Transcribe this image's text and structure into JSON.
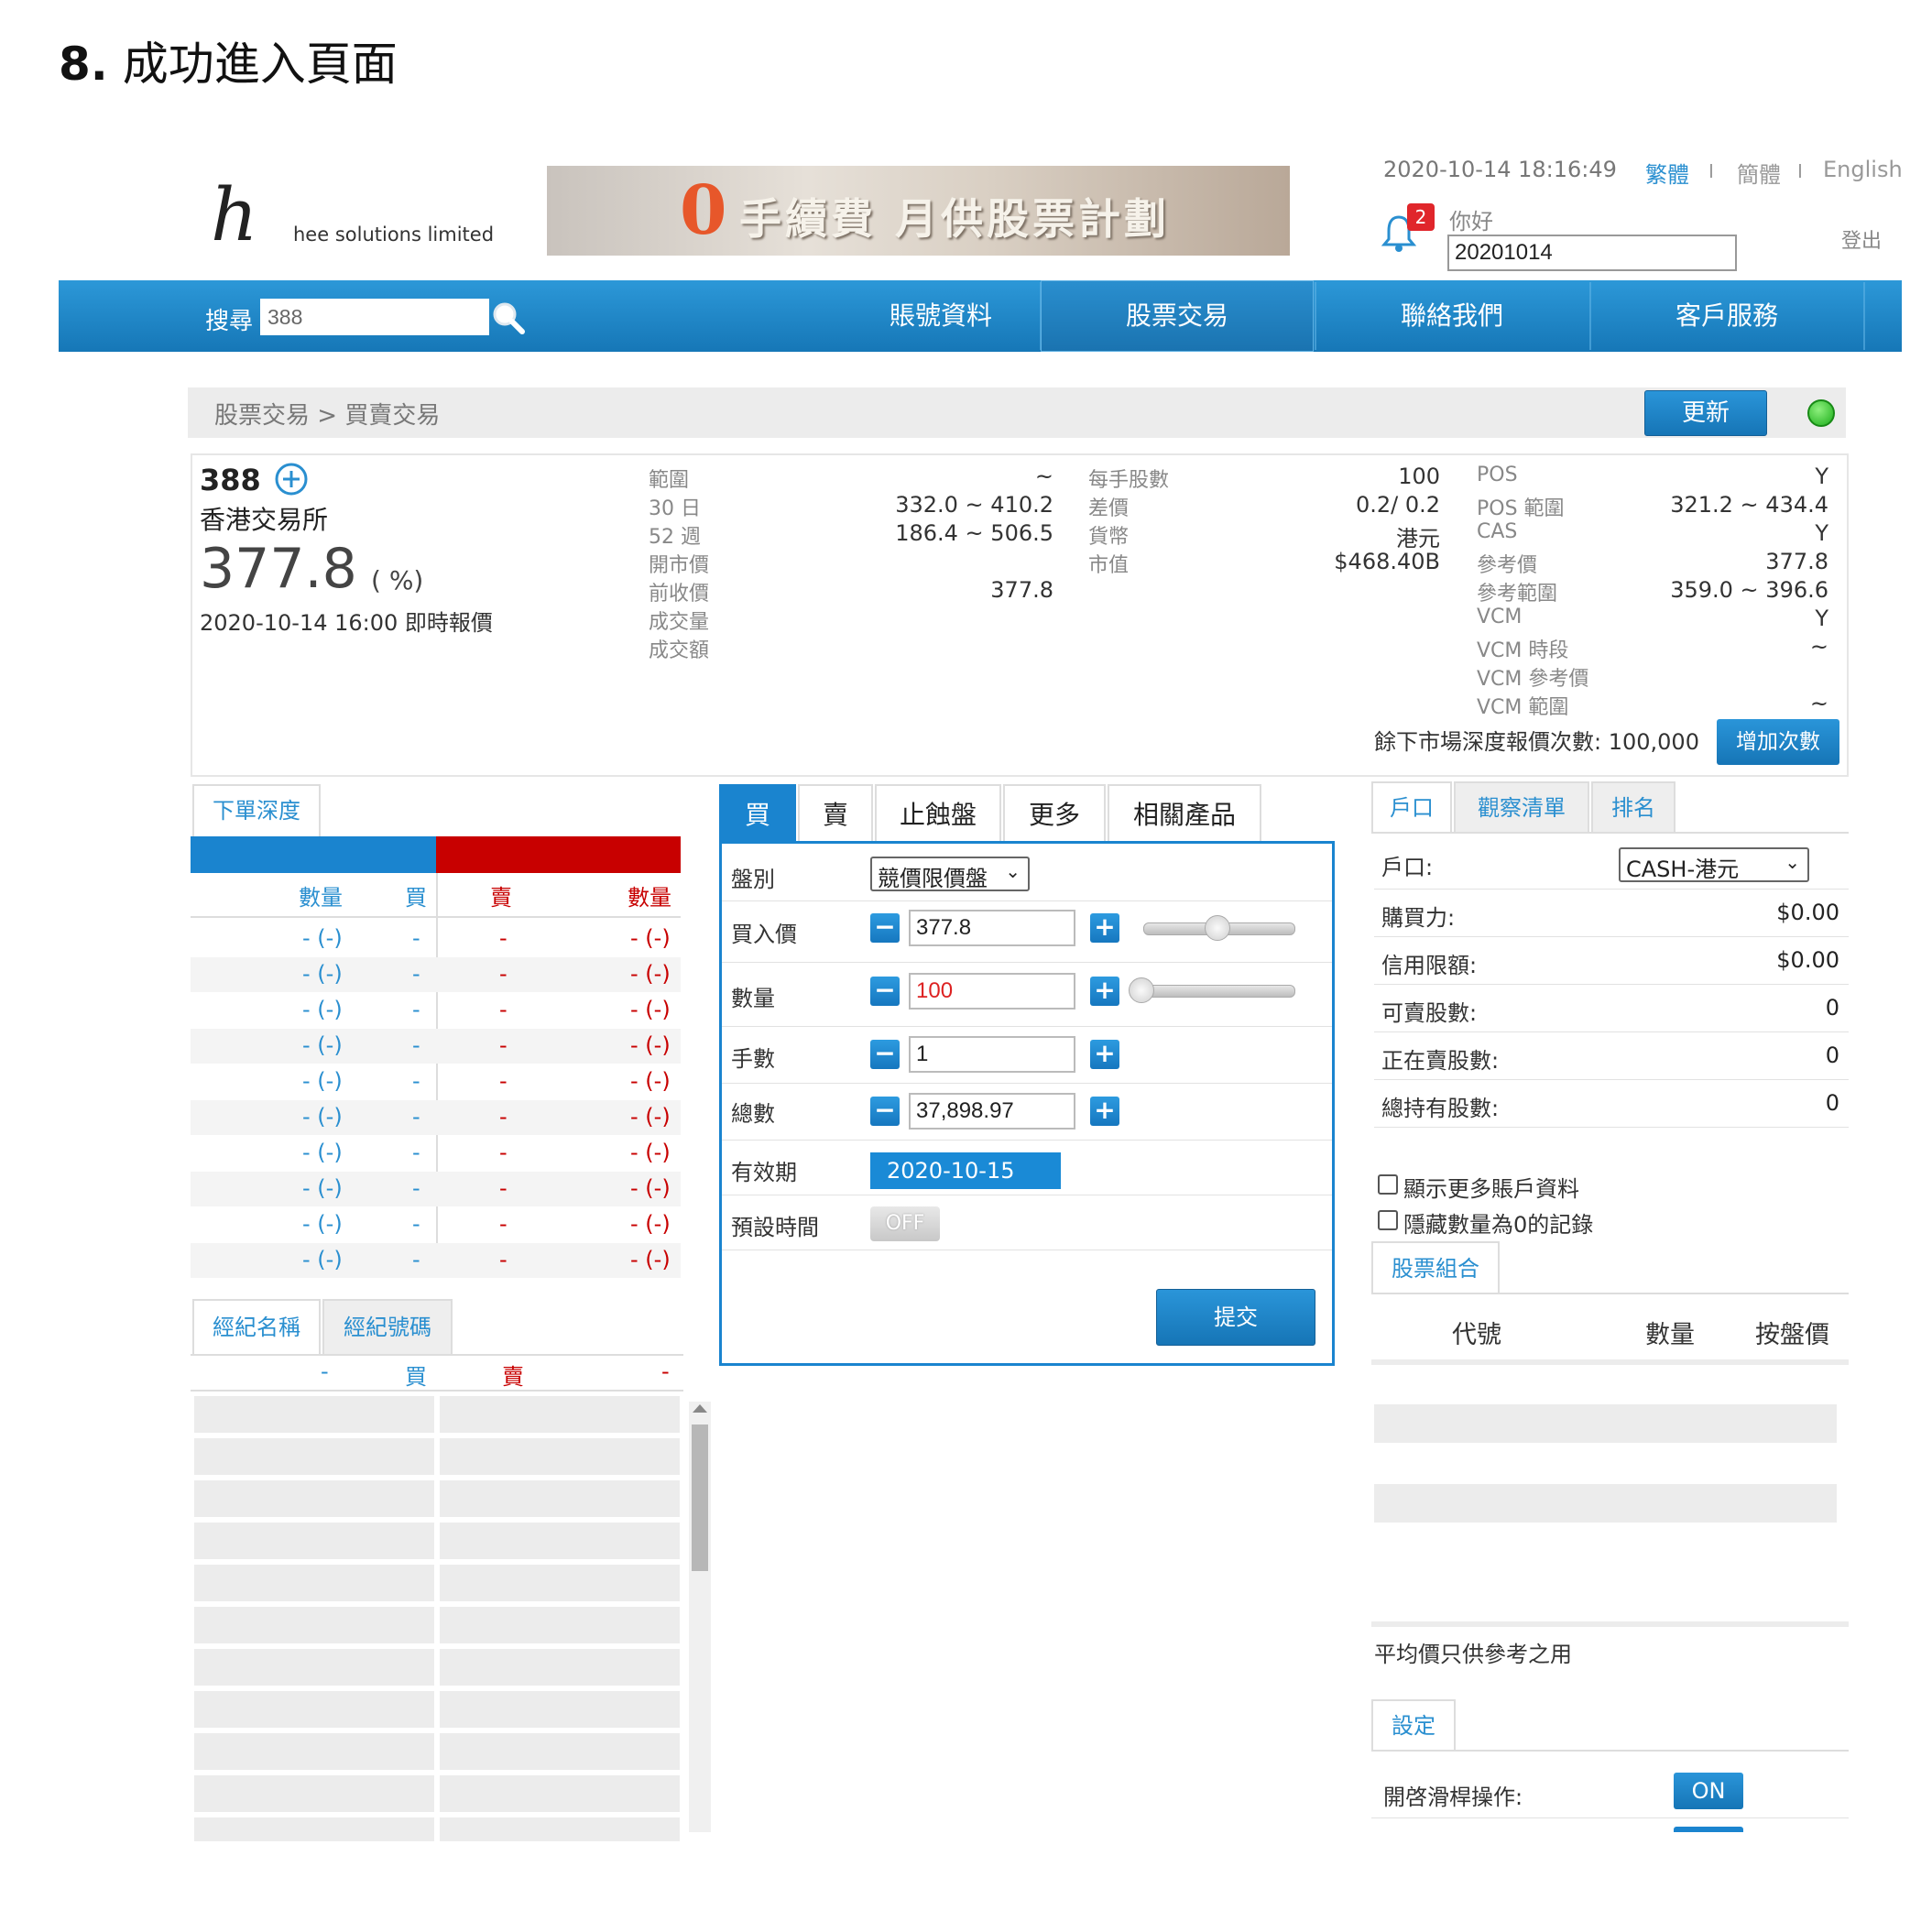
{
  "doc": {
    "step": "8.",
    "title": "成功進入頁面"
  },
  "header": {
    "logo_mark": "h",
    "logo_text": "hee solutions limited",
    "banner_zero": "0",
    "banner_text": "手續費 月供股票計劃",
    "datetime": "2020-10-14 18:16:49",
    "lang_trad": "繁體",
    "lang_simp": "簡體",
    "lang_en": "English",
    "sep": "I",
    "notif_count": "2",
    "greeting": "你好",
    "account_no": "20201014",
    "logout": "登出"
  },
  "nav": {
    "search_label": "搜尋",
    "search_value": "388",
    "items": [
      "賬號資料",
      "股票交易",
      "聯絡我們",
      "客戶服務"
    ]
  },
  "breadcrumb": {
    "text": "股票交易 > 買賣交易",
    "refresh": "更新"
  },
  "quote": {
    "code": "388",
    "exchange": "香港交易所",
    "price": "377.8",
    "pct": "(  %)",
    "time": "2020-10-14 16:00 即時報價",
    "col1": [
      {
        "label": "範圍",
        "value": "~"
      },
      {
        "label": "30 日",
        "value": "332.0 ~ 410.2"
      },
      {
        "label": "52 週",
        "value": "186.4 ~ 506.5"
      },
      {
        "label": "開市價",
        "value": ""
      },
      {
        "label": "前收價",
        "value": "377.8"
      },
      {
        "label": "成交量",
        "value": ""
      },
      {
        "label": "成交額",
        "value": ""
      }
    ],
    "col2": [
      {
        "label": "每手股數",
        "value": "100"
      },
      {
        "label": "差價",
        "value": "0.2/ 0.2"
      },
      {
        "label": "貨幣",
        "value": "港元"
      },
      {
        "label": "市值",
        "value": "$468.40B"
      }
    ],
    "col3": [
      {
        "label": "POS",
        "value": "Y"
      },
      {
        "label": "POS 範圍",
        "value": "321.2 ~ 434.4"
      },
      {
        "label": "CAS",
        "value": "Y"
      },
      {
        "label": "參考價",
        "value": "377.8"
      },
      {
        "label": "參考範圍",
        "value": "359.0 ~ 396.6"
      },
      {
        "label": "VCM",
        "value": "Y"
      },
      {
        "label": "VCM 時段",
        "value": "~"
      },
      {
        "label": "VCM 參考價",
        "value": ""
      },
      {
        "label": "VCM 範圍",
        "value": "~"
      }
    ],
    "remaining": "餘下市場深度報價次數: 100,000",
    "add_btn": "增加次數"
  },
  "depth": {
    "tab": "下單深度",
    "headers": {
      "qty_bid": "數量",
      "bid": "買",
      "ask": "賣",
      "qty_ask": "數量"
    },
    "rows": [
      {
        "bq": "- (-)",
        "b": "-",
        "a": "-",
        "aq": "- (-)"
      },
      {
        "bq": "- (-)",
        "b": "-",
        "a": "-",
        "aq": "- (-)"
      },
      {
        "bq": "- (-)",
        "b": "-",
        "a": "-",
        "aq": "- (-)"
      },
      {
        "bq": "- (-)",
        "b": "-",
        "a": "-",
        "aq": "- (-)"
      },
      {
        "bq": "- (-)",
        "b": "-",
        "a": "-",
        "aq": "- (-)"
      },
      {
        "bq": "- (-)",
        "b": "-",
        "a": "-",
        "aq": "- (-)"
      },
      {
        "bq": "- (-)",
        "b": "-",
        "a": "-",
        "aq": "- (-)"
      },
      {
        "bq": "- (-)",
        "b": "-",
        "a": "-",
        "aq": "- (-)"
      },
      {
        "bq": "- (-)",
        "b": "-",
        "a": "-",
        "aq": "- (-)"
      },
      {
        "bq": "- (-)",
        "b": "-",
        "a": "-",
        "aq": "- (-)"
      }
    ],
    "broker_tabs": [
      "經紀名稱",
      "經紀號碼"
    ],
    "broker_hdr": {
      "l": "-",
      "bid": "買",
      "ask": "賣",
      "r": "-"
    }
  },
  "order": {
    "tabs": [
      "買",
      "賣",
      "止蝕盤",
      "更多",
      "相關產品"
    ],
    "type_label": "盤別",
    "type_value": "競價限價盤",
    "price_label": "買入價",
    "price_value": "377.8",
    "qty_label": "數量",
    "qty_value": "100",
    "lots_label": "手數",
    "lots_value": "1",
    "total_label": "總數",
    "total_value": "37,898.97",
    "expiry_label": "有效期",
    "expiry_value": "2020-10-15",
    "preset_label": "預設時間",
    "preset_value": "OFF",
    "submit": "提交",
    "minus": "−",
    "plus": "+"
  },
  "account": {
    "tabs": [
      "戶口",
      "觀察清單",
      "排名"
    ],
    "acct_label": "戶口:",
    "acct_value": "CASH-港元",
    "rows": [
      {
        "label": "購買力:",
        "value": "$0.00"
      },
      {
        "label": "信用限額:",
        "value": "$0.00"
      },
      {
        "label": "可賣股數:",
        "value": "0"
      },
      {
        "label": "正在賣股數:",
        "value": "0"
      },
      {
        "label": "總持有股數:",
        "value": "0"
      }
    ],
    "check1": "顯示更多賬戶資料",
    "check2": "隱藏數量為0的記錄",
    "portfolio_tab": "股票組合",
    "port_headers": [
      "代號",
      "數量",
      "按盤價"
    ],
    "note": "平均價只供參考之用",
    "settings_tab": "設定",
    "slider_label": "開啓滑桿操作:",
    "slider_value": "ON"
  },
  "colors": {
    "primary": "#1a84cf",
    "ask_red": "#c80000",
    "link": "#2a8fd0"
  }
}
